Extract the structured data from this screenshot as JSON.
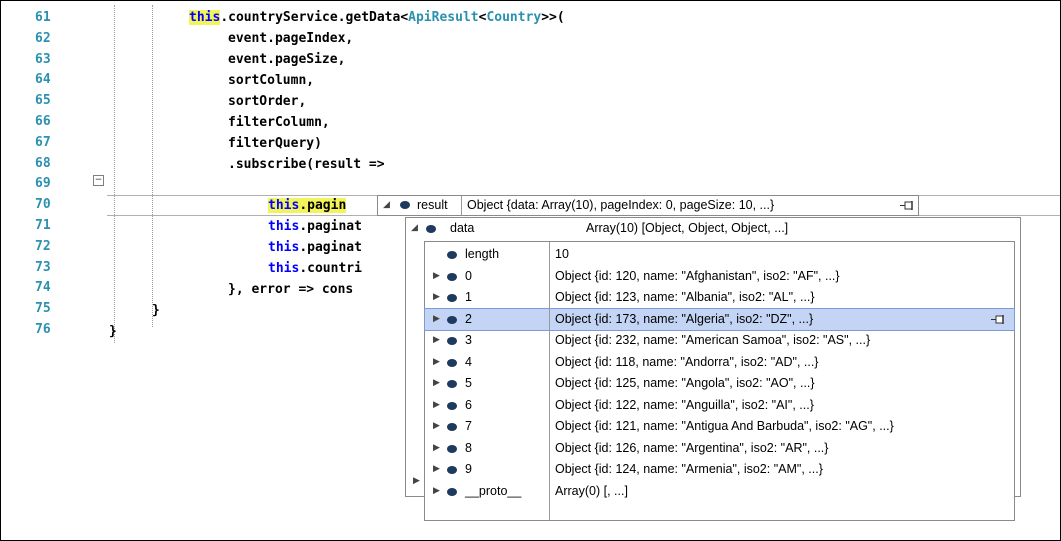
{
  "editor": {
    "lines": [
      {
        "num": "61"
      },
      {
        "num": "62"
      },
      {
        "num": "63"
      },
      {
        "num": "64"
      },
      {
        "num": "65"
      },
      {
        "num": "66"
      },
      {
        "num": "67"
      },
      {
        "num": "68"
      },
      {
        "num": "69"
      },
      {
        "num": "70"
      },
      {
        "num": "71"
      },
      {
        "num": "72"
      },
      {
        "num": "73"
      },
      {
        "num": "74"
      },
      {
        "num": "75"
      },
      {
        "num": "76"
      }
    ],
    "code": {
      "l61_kw": "this",
      "l61_a": ".countryService.getData<",
      "l61_t1": "ApiResult",
      "l61_b": "<",
      "l61_t2": "Country",
      "l61_c": ">>(",
      "l62": "event.pageIndex,",
      "l63": "event.pageSize,",
      "l64": "sortColumn,",
      "l65": "sortOrder,",
      "l66": "filterColumn,",
      "l67": "filterQuery)",
      "l68": ".subscribe(result =>",
      "l69_kw": "this",
      "l69_a": ".pagin",
      "l70_kw": "this",
      "l70_a": ".paginat",
      "l71_kw": "this",
      "l71_a": ".paginat",
      "l72_kw": "this",
      "l72_a": ".countri",
      "l73": "}, error => cons",
      "l74": "}",
      "l75": "}"
    },
    "collapse_glyph": "−"
  },
  "datatip": {
    "root": {
      "name": "result",
      "value": "Object {data: Array(10), pageIndex: 0, pageSize: 10, ...}"
    },
    "data": {
      "name": "data",
      "value": "Array(10) [Object, Object, Object, ...]"
    },
    "items": [
      {
        "name": "length",
        "value": "10",
        "expandable": false
      },
      {
        "name": "0",
        "value": "Object {id: 120, name: \"Afghanistan\", iso2: \"AF\", ...}",
        "expandable": true
      },
      {
        "name": "1",
        "value": "Object {id: 123, name: \"Albania\", iso2: \"AL\", ...}",
        "expandable": true
      },
      {
        "name": "2",
        "value": "Object {id: 173, name: \"Algeria\", iso2: \"DZ\", ...}",
        "expandable": true,
        "selected": true
      },
      {
        "name": "3",
        "value": "Object {id: 232, name: \"American Samoa\", iso2: \"AS\", ...}",
        "expandable": true
      },
      {
        "name": "4",
        "value": "Object {id: 118, name: \"Andorra\", iso2: \"AD\", ...}",
        "expandable": true
      },
      {
        "name": "5",
        "value": "Object {id: 125, name: \"Angola\", iso2: \"AO\", ...}",
        "expandable": true
      },
      {
        "name": "6",
        "value": "Object {id: 122, name: \"Anguilla\", iso2: \"AI\", ...}",
        "expandable": true
      },
      {
        "name": "7",
        "value": "Object {id: 121, name: \"Antigua And Barbuda\", iso2: \"AG\", ...}",
        "expandable": true
      },
      {
        "name": "8",
        "value": "Object {id: 126, name: \"Argentina\", iso2: \"AR\", ...}",
        "expandable": true
      },
      {
        "name": "9",
        "value": "Object {id: 124, name: \"Armenia\", iso2: \"AM\", ...}",
        "expandable": true
      },
      {
        "name": "__proto__",
        "value": "Array(0) [, ...]",
        "expandable": true
      }
    ],
    "truncated_suffix": "...}"
  },
  "colors": {
    "line_number": "#2b91af",
    "keyword": "#0000ff",
    "type": "#2b91af",
    "highlight": "#f3f35a",
    "selected_row": "#c4d4f5",
    "tip_border": "#8a8a8a"
  }
}
